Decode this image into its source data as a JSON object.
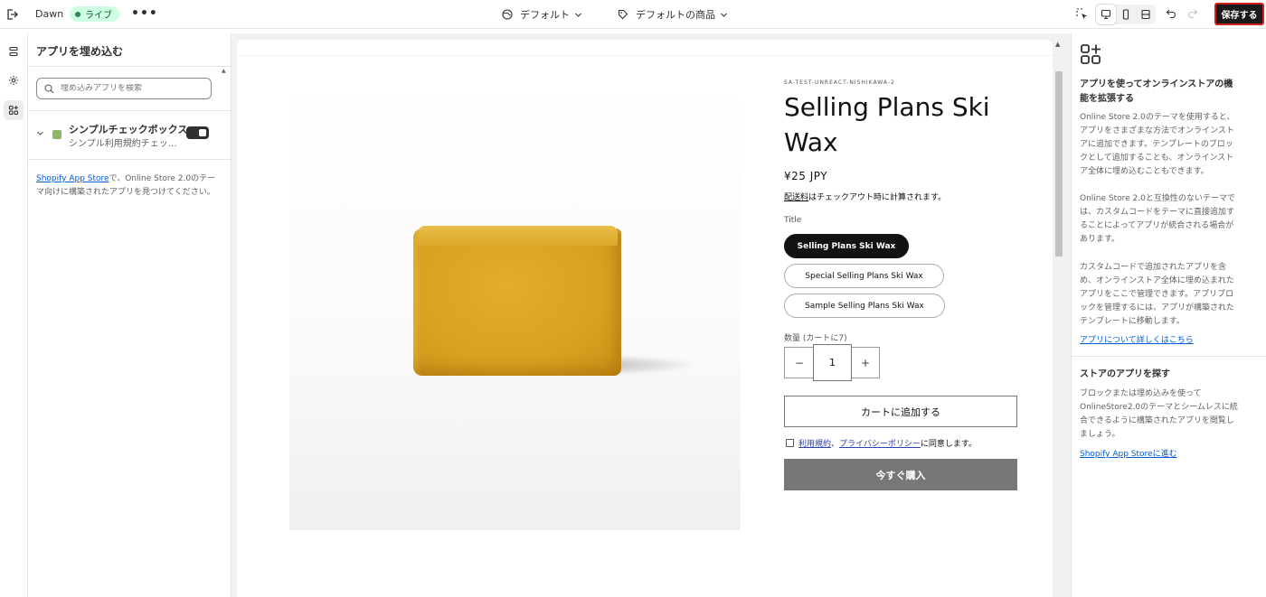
{
  "topbar": {
    "theme_name": "Dawn",
    "status_badge": "ライブ",
    "more_label": "•••",
    "template_label": "デフォルト",
    "product_label": "デフォルトの商品",
    "save_label": "保存する"
  },
  "left_panel": {
    "title": "アプリを埋め込む",
    "search_placeholder": "埋め込みアプリを検索",
    "app": {
      "name": "シンプルチェックボックス",
      "description": "シンプル利用規約チェッ…",
      "enabled": true
    },
    "info_link": "Shopify App Store",
    "info_text": "で、Online Store 2.0のテーマ向けに構築されたアプリを見つけてください。"
  },
  "product": {
    "vendor": "SA-TEST-UNREACT-NISHIKAWA-2",
    "title": "Selling Plans Ski Wax",
    "price": "¥25 JPY",
    "shipping_link": "配送料",
    "shipping_text": "はチェックアウト時に計算されます。",
    "option_label": "Title",
    "options": [
      {
        "label": "Selling Plans Ski Wax",
        "selected": true
      },
      {
        "label": "Special Selling Plans Ski Wax",
        "selected": false
      },
      {
        "label": "Sample Selling Plans Ski Wax",
        "selected": false
      }
    ],
    "quantity_label": "数量 (カートに7)",
    "quantity_value": "1",
    "minus": "−",
    "plus": "+",
    "add_to_cart": "カートに追加する",
    "terms_link_1": "利用規約",
    "terms_sep": "、",
    "terms_link_2": "プライバシーポリシー",
    "terms_suffix": "に同意します。",
    "buy_now": "今すぐ購入",
    "image_colors": {
      "soap": "#d9a121",
      "background": "#f7f7f7"
    }
  },
  "right_panel": {
    "heading": "アプリを使ってオンラインストアの機能を拡張する",
    "para1": "Online Store 2.0のテーマを使用すると、アプリをさまざまな方法でオンラインストアに追加できます。テンプレートのブロックとして追加することも、オンラインストア全体に埋め込むこともできます。",
    "para2": "Online Store 2.0と互換性のないテーマでは、カスタムコードをテーマに直接追加することによってアプリが統合される場合があります。",
    "para3": "カスタムコードで追加されたアプリを含め、オンラインストア全体に埋め込まれたアプリをここで管理できます。アプリブロックを管理するには、アプリが構築されたテンプレートに移動します。",
    "learn_more": "アプリについて詳しくはこちら",
    "section2_heading": "ストアのアプリを探す",
    "section2_text": "ブロックまたは埋め込みを使ってOnlineStore2.0のテーマとシームレスに統合できるように構築されたアプリを閲覧しましょう。",
    "section2_link": "Shopify App Storeに進む"
  },
  "colors": {
    "save_border": "#d4201c",
    "live_badge_bg": "#cdfee1",
    "link": "#005bd3"
  }
}
